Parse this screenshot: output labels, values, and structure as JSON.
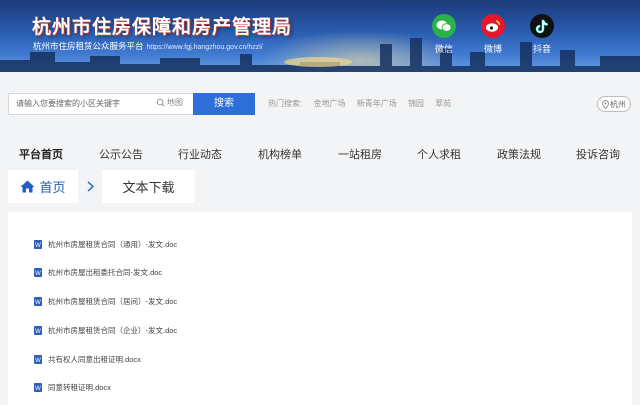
{
  "site": {
    "title": "杭州市住房保障和房产管理局",
    "subtitle": "杭州市住房租赁公众服务平台",
    "url": "https://www.fgj.hangzhou.gov.cn/hzzl/"
  },
  "social": [
    {
      "label": "微信",
      "icon": "wechat-icon",
      "color": "#2bb14a"
    },
    {
      "label": "微博",
      "icon": "weibo-icon",
      "color": "#e6162d"
    },
    {
      "label": "抖音",
      "icon": "douyin-icon",
      "color": "#111111"
    }
  ],
  "search": {
    "placeholder": "请输入您要搜索的小区关键字",
    "map_label": "地图",
    "button_label": "搜索",
    "hot_label": "热门搜索:",
    "hot_terms": [
      "金地广场",
      "新青年广场",
      "锦园",
      "翠苑"
    ],
    "city": "杭州"
  },
  "nav": [
    {
      "label": "平台首页",
      "active": true
    },
    {
      "label": "公示公告"
    },
    {
      "label": "行业动态"
    },
    {
      "label": "机构榜单"
    },
    {
      "label": "一站租房"
    },
    {
      "label": "个人求租"
    },
    {
      "label": "政策法规"
    },
    {
      "label": "投诉咨询"
    }
  ],
  "breadcrumb": {
    "home": "首页",
    "current": "文本下载"
  },
  "files": [
    "杭州市房屋租赁合同（通用）-发文.doc",
    "杭州市房屋出租委托合同-发文.doc",
    "杭州市房屋租赁合同（居间）-发文.doc",
    "杭州市房屋租赁合同（企业）-发文.doc",
    "共有权人同意出租证明.docx",
    "同意转租证明.docx"
  ],
  "colors": {
    "accent": "#2d6fd7",
    "banner": "#2a5db0"
  }
}
